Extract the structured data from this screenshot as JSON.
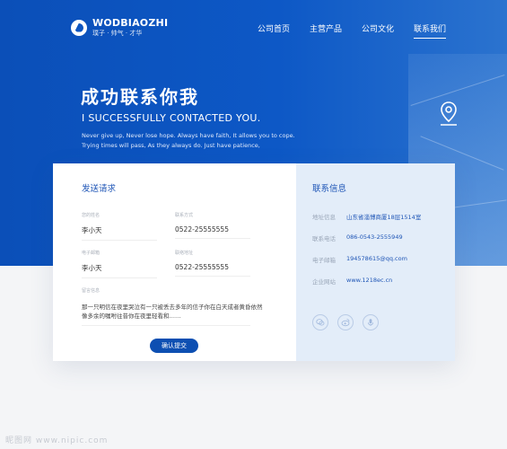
{
  "brand": {
    "name": "WODBIAOZHI",
    "slogan": "璞子 · 帅气 · 才华"
  },
  "nav": [
    {
      "label": "公司首页"
    },
    {
      "label": "主营产品"
    },
    {
      "label": "公司文化"
    },
    {
      "label": "联系我们",
      "active": true
    }
  ],
  "hero": {
    "title": "成功联系你我",
    "subtitle_en": "I SUCCESSFULLY CONTACTED YOU.",
    "lines": [
      "Never give up, Never lose hope. Always have faith, It allows you to cope.",
      "Trying times will pass, As they always do. Just have patience,"
    ]
  },
  "form": {
    "title": "发送请求",
    "fields": [
      {
        "label": "您的姓名",
        "value": "李小天"
      },
      {
        "label": "联系方式",
        "value": "0522-25555555"
      },
      {
        "label": "电子邮箱",
        "value": "李小天"
      },
      {
        "label": "联络地址",
        "value": "0522-25555555"
      }
    ],
    "message_label": "留言信息",
    "message_text": "那一只明信在夜里哭泣有一只被丢去多年的信子你在白天成者黄昏依然像多余的嘱咐往昔你在夜里轻看和……",
    "submit_label": "确认提交"
  },
  "info": {
    "title": "联系信息",
    "rows": [
      {
        "label": "地址信息",
        "value": "山东省淄博商厦18层1514室"
      },
      {
        "label": "联系电话",
        "value": "086-0543-2555949"
      },
      {
        "label": "电子邮箱",
        "value": "194578615@qq.com"
      },
      {
        "label": "企业网站",
        "value": "www.1218ec.cn"
      }
    ],
    "social_icons": [
      "wechat-icon",
      "weibo-icon",
      "mic-icon"
    ]
  },
  "watermark": "昵图网 www.nipic.com",
  "colors": {
    "primary": "#0d55c0",
    "panel": "#e3edf9",
    "accent_text": "#1e55b6"
  }
}
